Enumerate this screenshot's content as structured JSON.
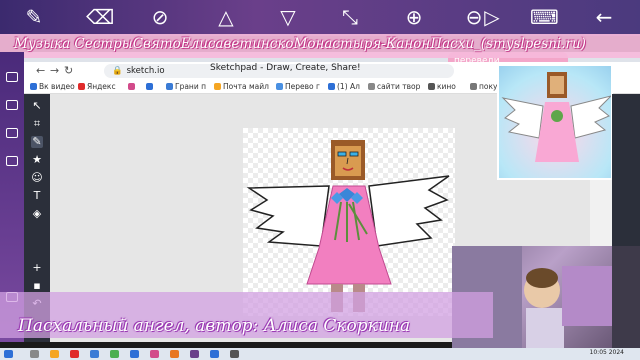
{
  "topbar": {
    "icons": [
      "pen-icon",
      "eraser-icon",
      "cross-eraser-icon",
      "triangle-up-icon",
      "triangle-down-icon",
      "resize-icon",
      "zoom-in-icon",
      "zoom-out-icon",
      "play-icon",
      "keyboard-icon",
      "back-arrow-icon"
    ]
  },
  "banner": {
    "text": "Музыка СестрыСвятоЕлисаветинскоМонастыря-КанонПасхи_(smyslpesni.ru)"
  },
  "browser": {
    "tab_title": "Sketchpad - Draw, Create, Share!",
    "active_tab_label": "переведи",
    "address": "sketch.io",
    "bookmarks": [
      {
        "label": "Вк видео",
        "color": "#2d6fd6"
      },
      {
        "label": "Яндекс",
        "color": "#e02b2b"
      },
      {
        "label": "",
        "color": "#d24a8a"
      },
      {
        "label": "",
        "color": "#2d6fd6"
      },
      {
        "label": "Грани п",
        "color": "#3a7bd5"
      },
      {
        "label": "Почта майл",
        "color": "#f5a623"
      },
      {
        "label": "Перево г",
        "color": "#4a90e2"
      },
      {
        "label": "(1) Ал",
        "color": "#2d6fd6"
      },
      {
        "label": "сайти твор",
        "color": "#888888"
      },
      {
        "label": "кино",
        "color": "#555555"
      },
      {
        "label": "покуп",
        "color": "#777777"
      }
    ]
  },
  "drawing": {
    "skin_color": "#d99b50",
    "hair_color": "#9a5a28",
    "dress_color": "#f27fc0",
    "wing_color": "#ffffff",
    "outline_color": "#222222"
  },
  "caption": {
    "text": "Пасхальный ангел, автор: Алиса Скоркина"
  },
  "taskbar": {
    "clock": "10:05 2024"
  }
}
